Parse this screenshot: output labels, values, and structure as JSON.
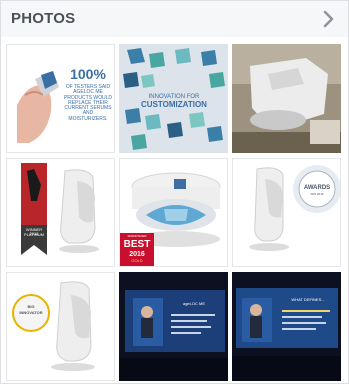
{
  "header": {
    "title": "PHOTOS"
  },
  "photos": [
    {
      "big": "100%",
      "caption": "OF TESTERS SAID AGELOC ME PRODUCTS WOULD REPLACE THEIR CURRENT SERUMS AND MOISTURIZERS."
    },
    {
      "caption_line1": "INNOVATION FOR",
      "caption_line2": "CUSTOMIZATION"
    },
    {},
    {
      "award_line1": "WINNER 2016",
      "award_line2": "PLATINUM"
    },
    {
      "badge_top": "SPADFINDER",
      "badge_big": "BEST",
      "badge_year": "2016",
      "badge_sub": "GOLD"
    },
    {
      "award": "AWARDS",
      "award_sub": "SPA 2016"
    },
    {
      "badge_line1": "BIG",
      "badge_line2": "INNOVATOR"
    },
    {
      "screen_title": "ageLOC ME"
    },
    {
      "screen_title": "WHAT DEFINES..."
    }
  ]
}
